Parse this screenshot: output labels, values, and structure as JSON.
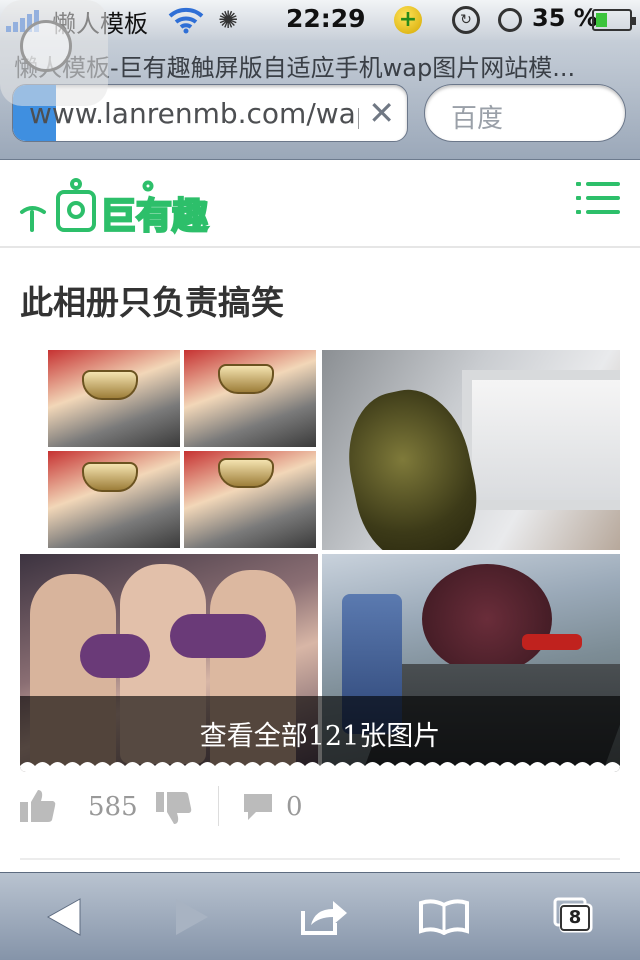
{
  "status_bar": {
    "carrier": "懒人模板",
    "time": "22:29",
    "battery_percent": "35 %",
    "battery_level": 0.35
  },
  "browser": {
    "page_title": "懒人模板-巨有趣触屏版自适应手机wap图片网站模...",
    "url": "www.lanrenmb.com/wap",
    "search_placeholder": "百度",
    "load_progress": 0.11,
    "tab_count": "8"
  },
  "site": {
    "logo_text": "巨有趣"
  },
  "album": {
    "title": "此相册只负责搞笑",
    "view_all_label": "查看全部121张图片",
    "likes": "585",
    "comments": "0"
  },
  "colors": {
    "brand_green": "#2dbf6a",
    "toolbar_blue": "#8594a9"
  },
  "icons": [
    "signal-icon",
    "wifi-icon",
    "spinner-icon",
    "plus-icon",
    "rotation-lock-icon",
    "alarm-icon",
    "battery-icon",
    "clear-icon",
    "menu-icon",
    "thumbs-up-icon",
    "thumbs-down-icon",
    "comment-icon",
    "back-icon",
    "forward-icon",
    "share-icon",
    "bookmarks-icon",
    "tabs-icon"
  ]
}
